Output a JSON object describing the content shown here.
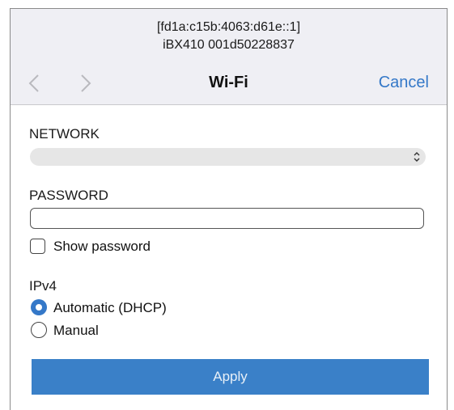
{
  "header": {
    "host_address": "[fd1a:c15b:4063:d61e::1]",
    "device_name": "iBX410 001d50228837",
    "title": "Wi-Fi",
    "cancel_label": "Cancel",
    "back_icon": "chevron-left-icon",
    "forward_icon": "chevron-right-icon"
  },
  "form": {
    "network": {
      "label": "NETWORK",
      "selected_value": "",
      "icon": "up-down-chevron-icon"
    },
    "password": {
      "label": "PASSWORD",
      "value": "",
      "show_password_label": "Show password",
      "show_password_checked": false
    },
    "ipv4": {
      "label": "IPv4",
      "options": [
        {
          "label": "Automatic (DHCP)",
          "selected": true
        },
        {
          "label": "Manual",
          "selected": false
        }
      ]
    },
    "apply_label": "Apply"
  },
  "colors": {
    "accent": "#3478c8",
    "apply_button": "#3a80c8",
    "header_bg": "#efeff4",
    "select_bg": "#e6e6e6"
  }
}
